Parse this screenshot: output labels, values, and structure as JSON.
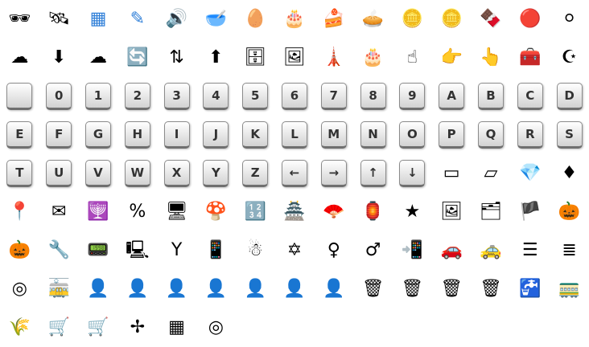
{
  "keys": {
    "digits": [
      "0",
      "1",
      "2",
      "3",
      "4",
      "5",
      "6",
      "7",
      "8",
      "9"
    ],
    "letters": [
      "A",
      "B",
      "C",
      "D",
      "E",
      "F",
      "G",
      "H",
      "I",
      "J",
      "K",
      "L",
      "M",
      "N",
      "O",
      "P",
      "Q",
      "R",
      "S",
      "T",
      "U",
      "V",
      "W",
      "X",
      "Y",
      "Z"
    ],
    "arrows": [
      "←",
      "→",
      "↑",
      "↓"
    ]
  },
  "rows": [
    [
      "3d-glasses-icon",
      "satellite-icon",
      "blueprint-icon",
      "blueprint-edit-icon",
      "speaker-box-icon",
      "bowl-icon",
      "egg-cup-icon",
      "cake-icon",
      "cake-slice-icon",
      "pie-slice-icon",
      "gold-coin-stack-icon",
      "coin-stack-icon",
      "chocolate-bar-icon",
      "christmas-ball-red-icon",
      "christmas-ball-silver-icon"
    ],
    [
      "cloud-icon",
      "cloud-download-icon",
      "cloud-network-icon",
      "cloud-sync-icon",
      "cloud-up-down-icon",
      "cloud-upload-icon",
      "cloud-database-icon",
      "easel-icon",
      "eiffel-tower-icon",
      "birthday-cake-icon",
      "hand-touch-icon",
      "hand-point-icon",
      "hand-tap-icon",
      "safe-box-icon",
      "crescent-star-icon"
    ],
    [
      "key-blank",
      "key-0",
      "key-1",
      "key-2",
      "key-3",
      "key-4",
      "key-5",
      "key-6",
      "key-7",
      "key-8",
      "key-9",
      "key-A",
      "key-B",
      "key-C",
      "key-D"
    ],
    [
      "key-E",
      "key-F",
      "key-G",
      "key-H",
      "key-I",
      "key-J",
      "key-K",
      "key-L",
      "key-M",
      "key-N",
      "key-O",
      "key-P",
      "key-Q",
      "key-R",
      "key-S"
    ],
    [
      "key-T",
      "key-U",
      "key-V",
      "key-W",
      "key-X",
      "key-Y",
      "key-Z",
      "key-left",
      "key-right",
      "key-up",
      "key-down",
      "eraser-icon",
      "eraser-large-icon",
      "green-gem-icon",
      "red-gem-icon"
    ],
    [
      "map-pin-icon",
      "cloud-mail-icon",
      "menorah-icon",
      "percent-coins-icon",
      "monitor-icon",
      "mushroom-icon",
      "counter-icon",
      "pagoda-icon",
      "hand-fan-icon",
      "lantern-icon",
      "sea-star-icon",
      "picture-icon",
      "pictures-icon",
      "pirate-ship-icon",
      "pumpkin-icon"
    ],
    [
      "jack-o-lantern-icon",
      "wrench-bottle-icon",
      "scoreboard-icon",
      "cloud-server-icon",
      "slingshot-icon",
      "cloud-tablet-icon",
      "snowman-icon",
      "star-of-david-icon",
      "female-symbol-icon",
      "male-symbol-icon",
      "tablet-icon",
      "taxi-white-icon",
      "taxi-yellow-icon",
      "list-icon",
      "numbered-list-icon"
    ],
    [
      "signal-target-icon",
      "tram-icon",
      "user-gray-icon",
      "user-light-icon",
      "user-black-icon",
      "user-blue-icon",
      "user-green-icon",
      "user-red-icon",
      "user-yellow-icon",
      "trash-can-blue-icon",
      "trash-can-green-icon",
      "trash-can-black-icon",
      "trash-can-yellow-icon",
      "water-tap-icon",
      "tram-car-icon"
    ],
    [
      "wheat-icon",
      "wheelbarrow-icon",
      "wheelbarrow-full-icon",
      "windmill-icon",
      "window-grid-icon",
      "window-target-icon"
    ]
  ],
  "colors": {
    "background": "#ffffff",
    "key_face": "#e8e8e8",
    "key_text": "#333333"
  }
}
